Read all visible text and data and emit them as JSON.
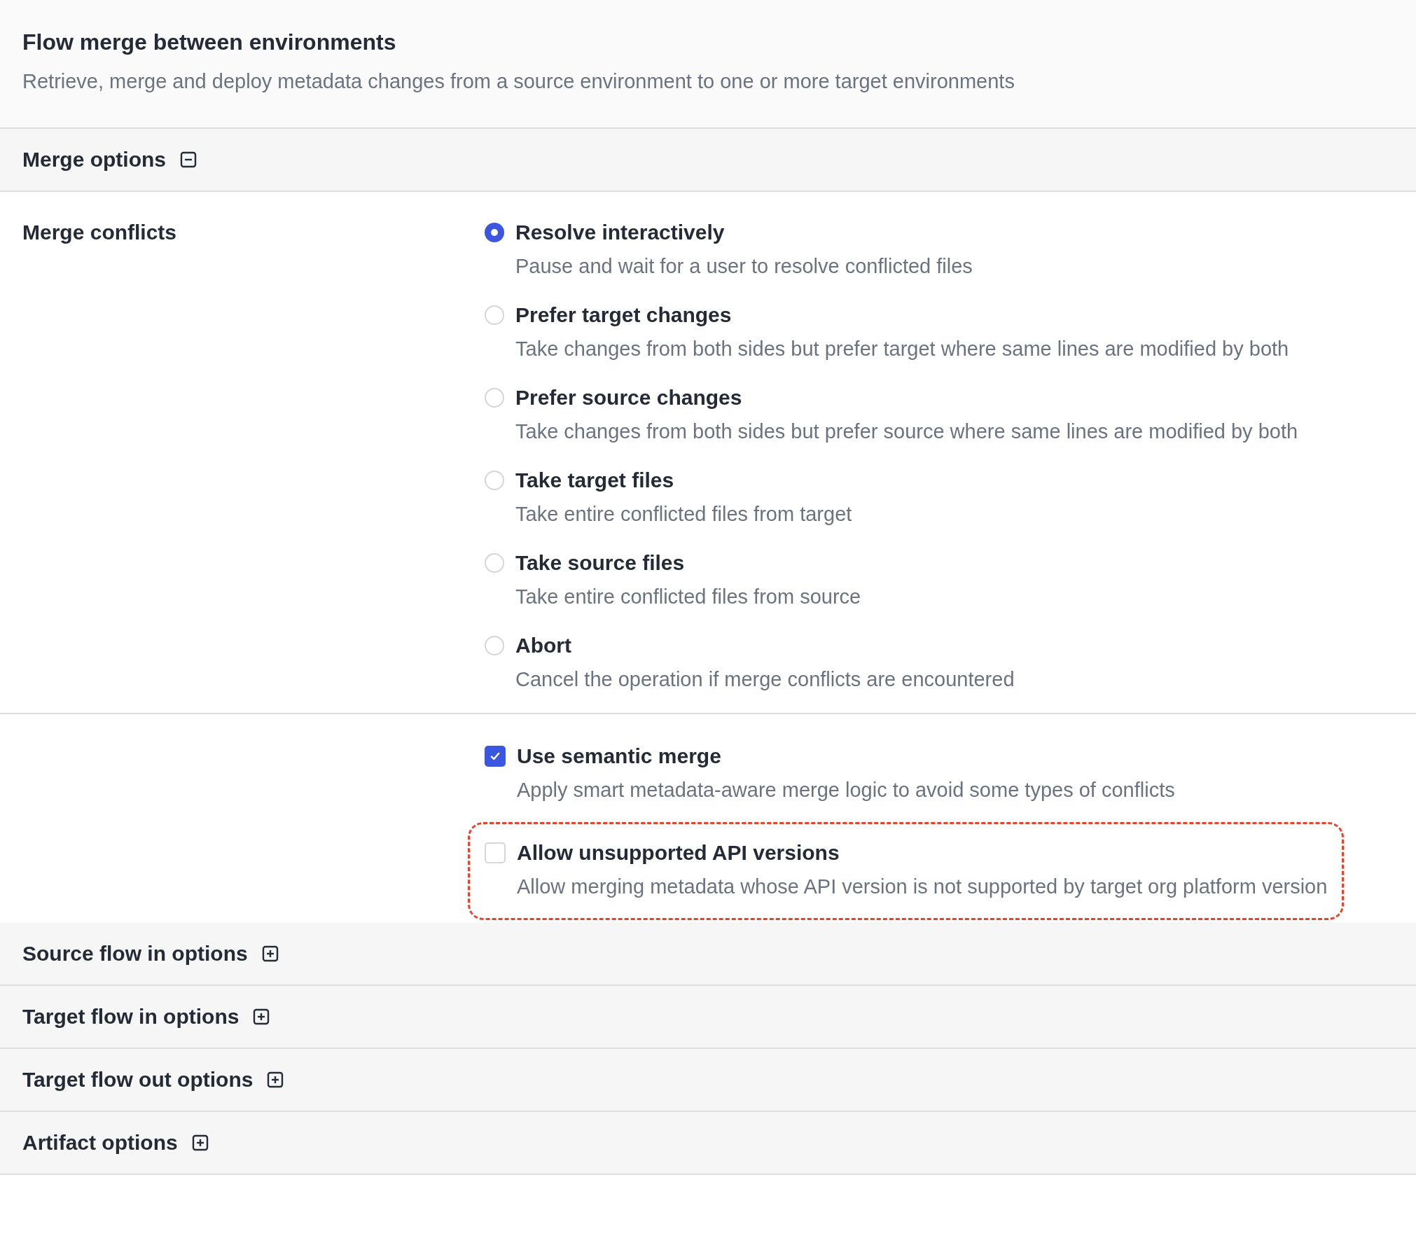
{
  "header": {
    "title": "Flow merge between environments",
    "subtitle": "Retrieve, merge and deploy metadata changes from a source environment to one or more target environments"
  },
  "merge_options": {
    "title": "Merge options",
    "expanded": true,
    "merge_conflicts": {
      "label": "Merge conflicts",
      "options": [
        {
          "label": "Resolve interactively",
          "description": "Pause and wait for a user to resolve conflicted files",
          "selected": true
        },
        {
          "label": "Prefer target changes",
          "description": "Take changes from both sides but prefer target where same lines are modified by both",
          "selected": false
        },
        {
          "label": "Prefer source changes",
          "description": "Take changes from both sides but prefer source where same lines are modified by both",
          "selected": false
        },
        {
          "label": "Take target files",
          "description": "Take entire conflicted files from target",
          "selected": false
        },
        {
          "label": "Take source files",
          "description": "Take entire conflicted files from source",
          "selected": false
        },
        {
          "label": "Abort",
          "description": "Cancel the operation if merge conflicts are encountered",
          "selected": false
        }
      ]
    },
    "checkboxes": [
      {
        "label": "Use semantic merge",
        "description": "Apply smart metadata-aware merge logic to avoid some types of conflicts",
        "checked": true,
        "highlighted": false
      },
      {
        "label": "Allow unsupported API versions",
        "description": "Allow merging metadata whose API version is not supported by target org platform version",
        "checked": false,
        "highlighted": true
      }
    ]
  },
  "collapsed_sections": [
    {
      "title": "Source flow in options",
      "expanded": false
    },
    {
      "title": "Target flow in options",
      "expanded": false
    },
    {
      "title": "Target flow out options",
      "expanded": false
    },
    {
      "title": "Artifact options",
      "expanded": false
    }
  ]
}
